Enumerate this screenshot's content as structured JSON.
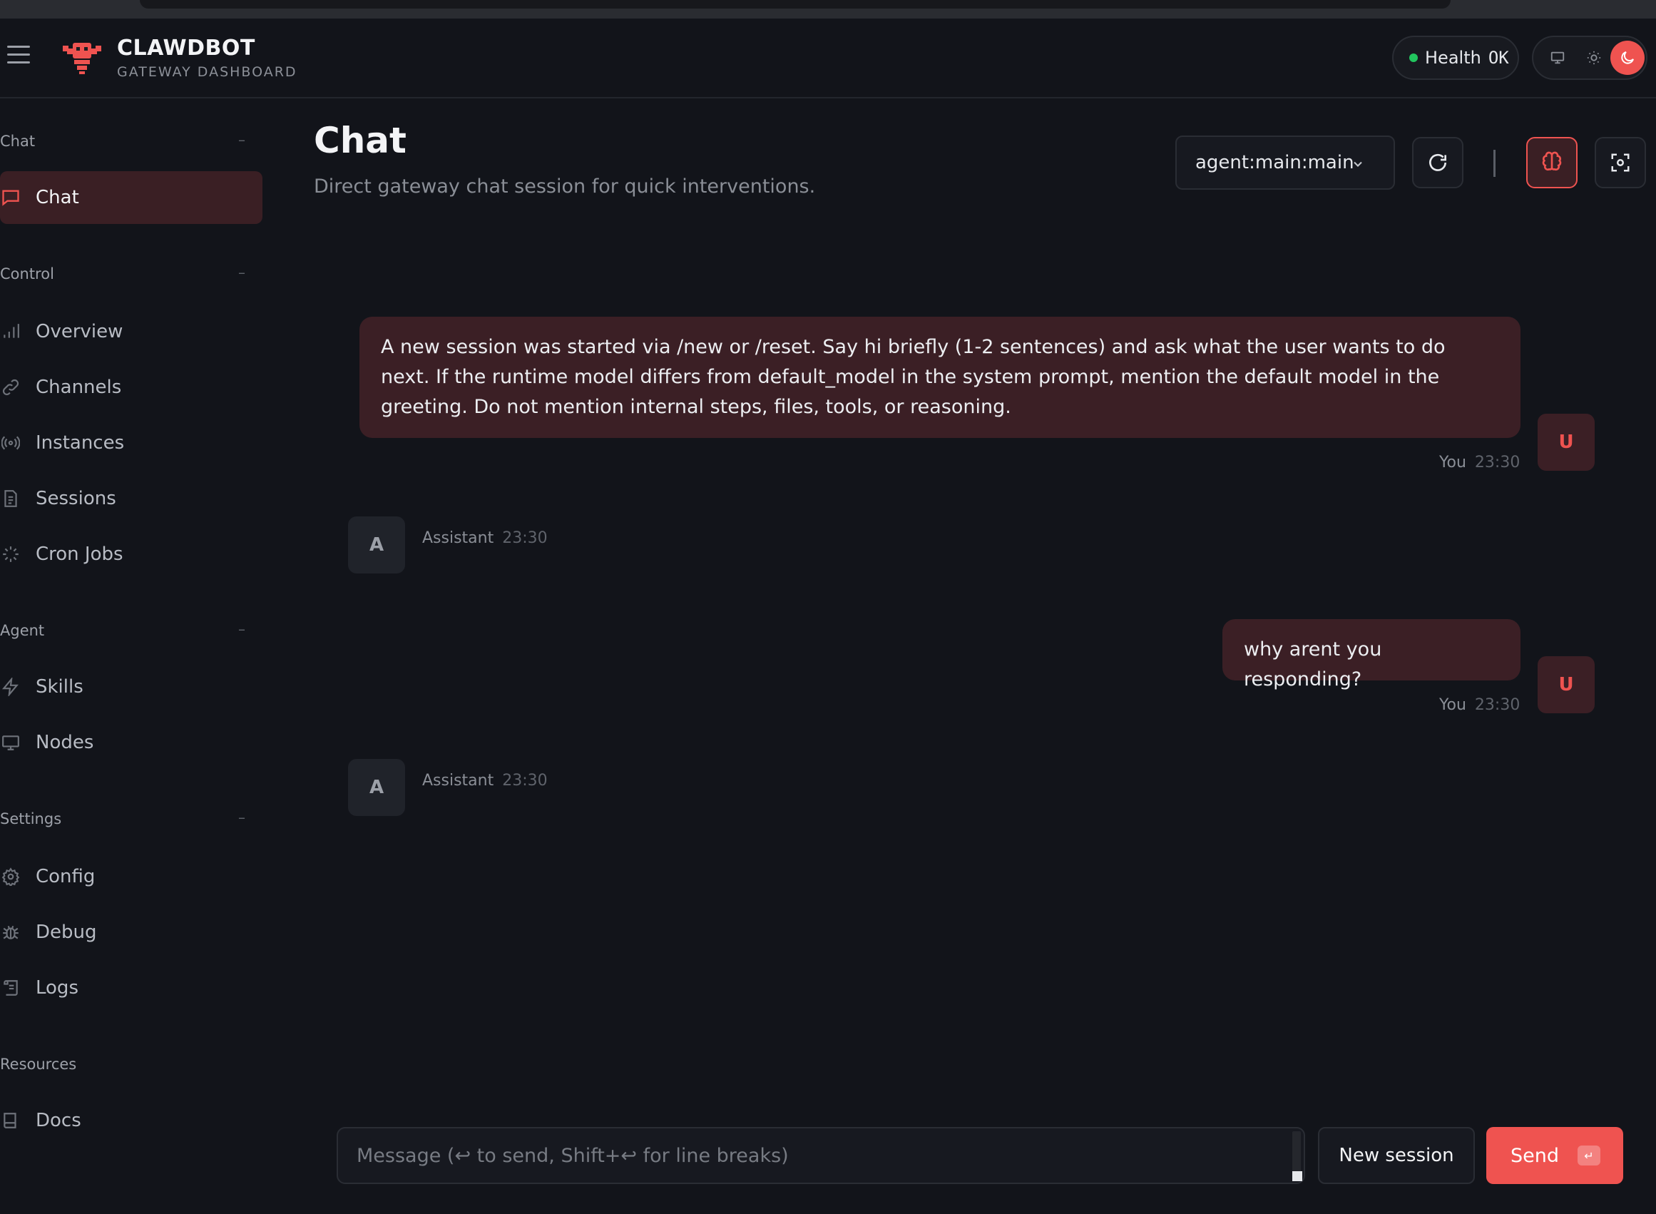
{
  "brand": {
    "title": "CLAWDBOT",
    "subtitle": "GATEWAY DASHBOARD"
  },
  "health": {
    "label": "Health",
    "status": "OK",
    "status_color": "#22c55e"
  },
  "theme": {
    "options": [
      "monitor-icon",
      "sun-icon",
      "moon-icon"
    ],
    "active": "moon-icon"
  },
  "sidebar": {
    "sections": [
      {
        "title": "Chat",
        "collapse": "–"
      },
      {
        "title": "Control",
        "collapse": "–"
      },
      {
        "title": "Agent",
        "collapse": "–"
      },
      {
        "title": "Settings",
        "collapse": "–"
      },
      {
        "title": "Resources"
      }
    ],
    "items": [
      {
        "label": "Chat",
        "icon": "message-icon",
        "active": true
      },
      {
        "label": "Overview",
        "icon": "bar-chart-icon"
      },
      {
        "label": "Channels",
        "icon": "link-icon"
      },
      {
        "label": "Instances",
        "icon": "radio-icon"
      },
      {
        "label": "Sessions",
        "icon": "document-icon"
      },
      {
        "label": "Cron Jobs",
        "icon": "loader-icon"
      },
      {
        "label": "Skills",
        "icon": "zap-icon"
      },
      {
        "label": "Nodes",
        "icon": "monitor-icon"
      },
      {
        "label": "Config",
        "icon": "gear-icon"
      },
      {
        "label": "Debug",
        "icon": "bug-icon"
      },
      {
        "label": "Logs",
        "icon": "scroll-icon"
      },
      {
        "label": "Docs",
        "icon": "book-icon"
      }
    ]
  },
  "main": {
    "title": "Chat",
    "subtitle": "Direct gateway chat session for quick interventions.",
    "session": "agent:main:main"
  },
  "messages": [
    {
      "role": "user",
      "author": "You",
      "time": "23:30",
      "avatar": "U",
      "text": "A new session was started via /new or /reset. Say hi briefly (1-2 sentences) and ask what the user wants to do next. If the runtime model differs from default_model in the system prompt, mention the default model in the greeting. Do not mention internal steps, files, tools, or reasoning."
    },
    {
      "role": "assistant",
      "author": "Assistant",
      "time": "23:30",
      "avatar": "A",
      "text": ""
    },
    {
      "role": "user",
      "author": "You",
      "time": "23:30",
      "avatar": "U",
      "text": "why arent you responding?"
    },
    {
      "role": "assistant",
      "author": "Assistant",
      "time": "23:30",
      "avatar": "A",
      "text": ""
    }
  ],
  "composer": {
    "placeholder": "Message (↩ to send, Shift+↩ for line breaks)",
    "new_session_label": "New session",
    "send_label": "Send",
    "send_kbd": "↵"
  },
  "colors": {
    "accent": "#ef5350",
    "user_bubble": "#3b1f25",
    "background": "#12141a"
  }
}
